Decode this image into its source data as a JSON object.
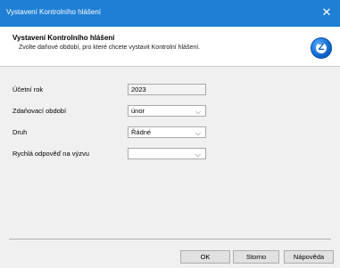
{
  "window": {
    "title": "Vystavení Kontrolního hlášení",
    "close_glyph": "✕"
  },
  "header": {
    "title": "Vystavení Kontrolního hlášení",
    "subtitle": "Zvolte daňové období, pro které chcete vystavit Kontrolní hlášení.",
    "logo_icon": "app-logo-icon",
    "logo_glyph": "Z"
  },
  "form": {
    "year": {
      "label": "Účetní rok",
      "value": "2023"
    },
    "period": {
      "label": "Zdaňovací období",
      "value": "únor"
    },
    "kind": {
      "label": "Druh",
      "value": "Řádné"
    },
    "quick_reply": {
      "label": "Rychlá odpověď na výzvu",
      "value": ""
    },
    "caret_glyph": "⌵"
  },
  "buttons": {
    "ok": "OK",
    "cancel": "Storno",
    "help": "Nápověda"
  },
  "colors": {
    "titlebar": "#1e7fd4",
    "dialog_bg": "#f0f0f0",
    "header_bg": "#ffffff"
  }
}
